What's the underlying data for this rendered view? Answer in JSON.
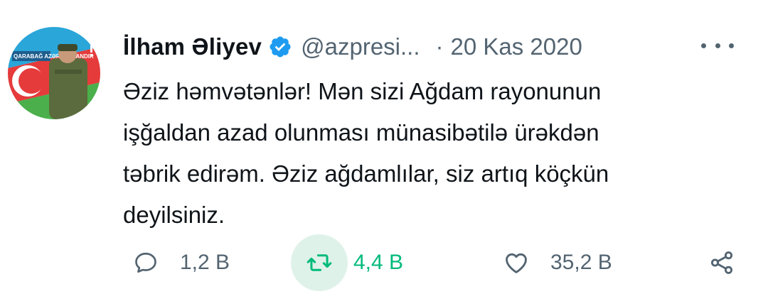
{
  "author": {
    "name": "İlham Əliyev",
    "handle": "@azpresi...",
    "separator": "·",
    "date": "20 Kas 2020",
    "avatar_caption": "QARABAĞ AZƏRBAYCANDIR"
  },
  "tweet": {
    "text": "Əziz həmvətənlər! Mən sizi Ağdam rayonunun\nişğaldan azad olunması münasibətilə ürəkdən\ntəbrik edirəm. Əziz ağdamlılar, siz artıq köçkün\ndeyilsiniz."
  },
  "actions": {
    "reply_count": "1,2 B",
    "retweet_count": "4,4 B",
    "like_count": "35,2 B"
  },
  "icons": {
    "verified": "verified-badge-icon",
    "more": "more-icon",
    "reply": "reply-icon",
    "retweet": "retweet-icon",
    "like": "heart-icon",
    "share": "share-icon"
  },
  "colors": {
    "verified_blue": "#1d9bf0",
    "retweet_green": "#00ba7c",
    "retweet_highlight": "#dff2e9",
    "secondary_text": "#536471",
    "primary_text": "#0f1419"
  }
}
